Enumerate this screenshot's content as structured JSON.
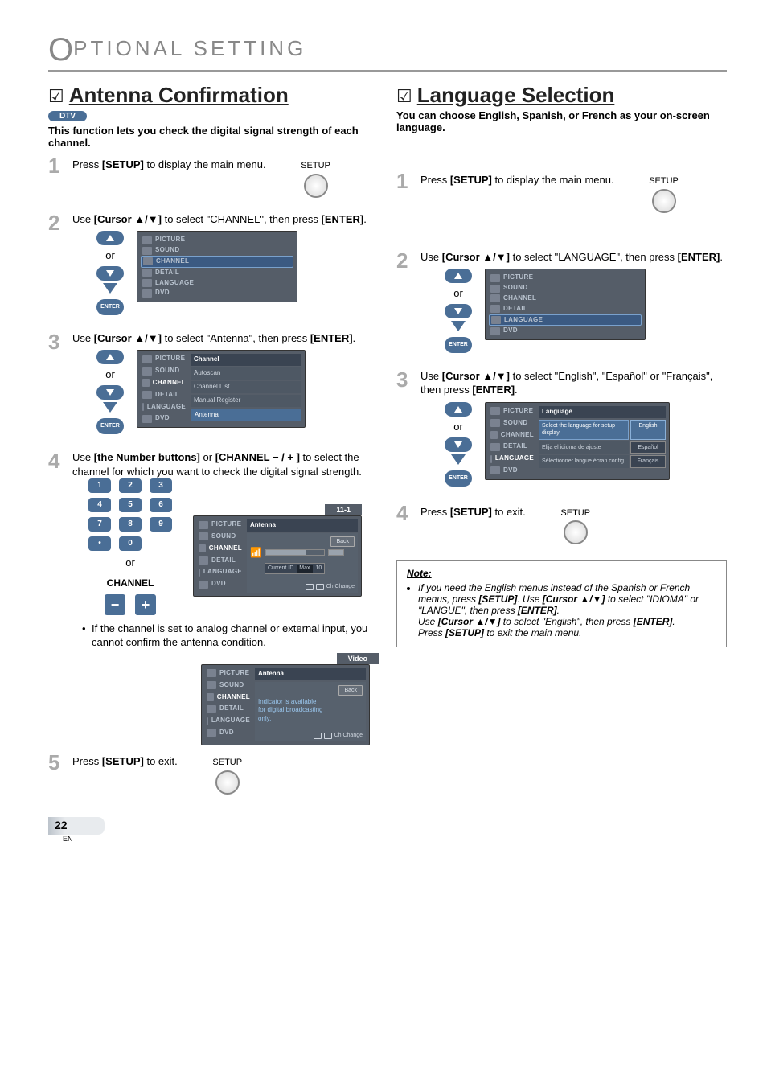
{
  "header": {
    "o": "O",
    "title": "PTIONAL  SETTING"
  },
  "left": {
    "check": "☑",
    "title": "Antenna Confirmation",
    "dtv": "DTV",
    "intro": "This function lets you check the digital signal strength of each channel.",
    "step1": {
      "num": "1",
      "a": "Press ",
      "b": "[SETUP]",
      "c": " to display the main menu.",
      "setup": "SETUP"
    },
    "step2": {
      "num": "2",
      "a": "Use ",
      "b": "[Cursor ▲/▼]",
      "c": " to select \"CHANNEL\", then press ",
      "d": "[ENTER]",
      "e": ".",
      "or": "or",
      "enter": "ENTER"
    },
    "menu2": {
      "items": [
        "PICTURE",
        "SOUND",
        "CHANNEL",
        "DETAIL",
        "LANGUAGE",
        "DVD"
      ],
      "active": "CHANNEL"
    },
    "step3": {
      "num": "3",
      "a": "Use ",
      "b": "[Cursor ▲/▼]",
      "c": " to select \"Antenna\", then press ",
      "d": "[ENTER]",
      "e": ".",
      "or": "or",
      "enter": "ENTER"
    },
    "menu3": {
      "title": "Channel",
      "items": [
        "Autoscan",
        "Channel List",
        "Manual Register",
        "Antenna"
      ],
      "active": "Antenna"
    },
    "step4": {
      "num": "4",
      "a": "Use ",
      "b": "[the Number buttons]",
      "c": " or ",
      "d": "[CHANNEL − / + ]",
      "e": " to select the channel for which you want to check the digital signal strength."
    },
    "keypad": {
      "k": [
        "1",
        "2",
        "3",
        "4",
        "5",
        "6",
        "7",
        "8",
        "9",
        "•",
        "0"
      ],
      "or": "or",
      "channel": "CHANNEL",
      "minus": "−",
      "plus": "+"
    },
    "antPanel": {
      "tag": "11-1",
      "title": "Antenna",
      "back": "Back",
      "curid": "Current ID",
      "max": "Max",
      "val": "10",
      "ch": "Ch Change"
    },
    "bullet": "If the channel is set to analog channel or external input, you cannot confirm the antenna condition.",
    "vidPanel": {
      "tag": "Video",
      "title": "Antenna",
      "back": "Back",
      "msg1": "Indicator is available",
      "msg2": "for digital broadcasting",
      "msg3": "only.",
      "ch": "Ch Change"
    },
    "step5": {
      "num": "5",
      "a": "Press ",
      "b": "[SETUP]",
      "c": " to exit.",
      "setup": "SETUP"
    }
  },
  "right": {
    "check": "☑",
    "title": "Language Selection",
    "intro": "You can choose English, Spanish, or French as your on-screen language.",
    "step1": {
      "num": "1",
      "a": "Press ",
      "b": "[SETUP]",
      "c": " to display the main menu.",
      "setup": "SETUP"
    },
    "step2": {
      "num": "2",
      "a": "Use ",
      "b": "[Cursor ▲/▼]",
      "c": " to select \"LANGUAGE\", then press ",
      "d": "[ENTER]",
      "e": ".",
      "or": "or",
      "enter": "ENTER"
    },
    "menu2": {
      "items": [
        "PICTURE",
        "SOUND",
        "CHANNEL",
        "DETAIL",
        "LANGUAGE",
        "DVD"
      ],
      "active": "LANGUAGE"
    },
    "step3": {
      "num": "3",
      "a": "Use ",
      "b": "[Cursor ▲/▼]",
      "c": " to select \"English\", \"Español\" or \"Français\", then press ",
      "d": "[ENTER]",
      "e": ".",
      "or": "or",
      "enter": "ENTER"
    },
    "menu3": {
      "title": "Language",
      "rows": [
        {
          "desc": "Select the language for setup display",
          "opt": "English",
          "hl": true
        },
        {
          "desc": "Elija el idioma de ajuste",
          "opt": "Español",
          "hl": false
        },
        {
          "desc": "Sélectionner langue écran config",
          "opt": "Français",
          "hl": false
        }
      ]
    },
    "step4": {
      "num": "4",
      "a": "Press ",
      "b": "[SETUP]",
      "c": " to exit.",
      "setup": "SETUP"
    },
    "note": {
      "title": "Note:",
      "line1a": "If you need the English menus instead of the Spanish or French menus, press ",
      "line1b": "[SETUP]",
      "line1c": ". Use ",
      "line1d": "[Cursor ▲/▼]",
      "line1e": " to select \"IDIOMA\" or \"LANGUE\", then press ",
      "line1f": "[ENTER]",
      "line1g": ".",
      "line2a": "Use ",
      "line2b": "[Cursor ▲/▼]",
      "line2c": " to select \"English\", then press ",
      "line2d": "[ENTER]",
      "line2e": ".",
      "line3a": "Press ",
      "line3b": "[SETUP]",
      "line3c": " to exit the main menu."
    }
  },
  "footer": {
    "page": "22",
    "en": "EN"
  }
}
